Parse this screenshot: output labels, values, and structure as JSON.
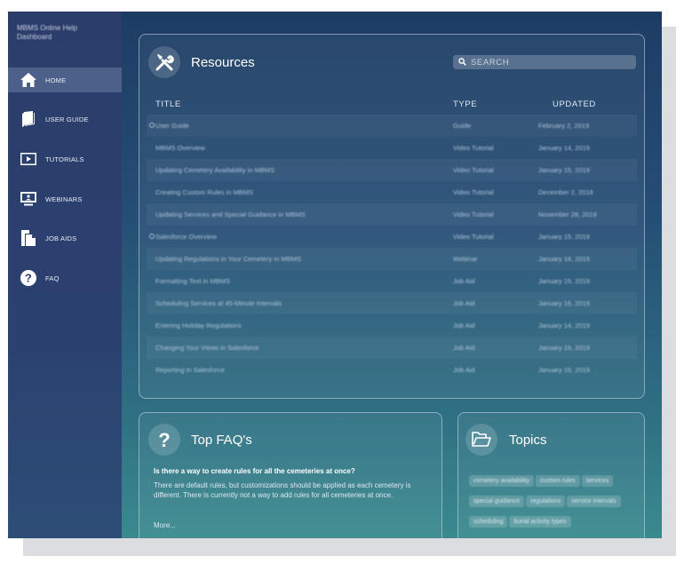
{
  "sidebar": {
    "brand": "MBMS Online Help Dashboard",
    "items": [
      {
        "label": "HOME",
        "icon": "home-icon",
        "active": true
      },
      {
        "label": "USER GUIDE",
        "icon": "book-icon",
        "active": false
      },
      {
        "label": "TUTORIALS",
        "icon": "play-icon",
        "active": false
      },
      {
        "label": "WEBINARS",
        "icon": "presentation-icon",
        "active": false
      },
      {
        "label": "JOB AIDS",
        "icon": "document-icon",
        "active": false
      },
      {
        "label": "FAQ",
        "icon": "question-icon",
        "active": false
      }
    ]
  },
  "resources": {
    "title": "Resources",
    "icon": "tools-icon",
    "search_placeholder": "SEARCH",
    "columns": {
      "title": "TITLE",
      "type": "TYPE",
      "updated": "UPDATED"
    },
    "rows": [
      {
        "title": "User Guide",
        "type": "Guide",
        "updated": "February 2, 2019",
        "marker": true
      },
      {
        "title": "MBMS Overview",
        "type": "Video Tutorial",
        "updated": "January 14, 2019",
        "marker": false
      },
      {
        "title": "Updating Cemetery Availability in MBMS",
        "type": "Video Tutorial",
        "updated": "January 15, 2019",
        "marker": false
      },
      {
        "title": "Creating Custom Rules in MBMS",
        "type": "Video Tutorial",
        "updated": "December 2, 2018",
        "marker": false
      },
      {
        "title": "Updating Services and Special Guidance in MBMS",
        "type": "Video Tutorial",
        "updated": "November 28, 2018",
        "marker": false
      },
      {
        "title": "Salesforce Overview",
        "type": "Video Tutorial",
        "updated": "January 15, 2019",
        "marker": true
      },
      {
        "title": "Updating Regulations in Your Cemetery in MBMS",
        "type": "Webinar",
        "updated": "January 16, 2019",
        "marker": false
      },
      {
        "title": "Formatting Text in MBMS",
        "type": "Job Aid",
        "updated": "January 15, 2019",
        "marker": false
      },
      {
        "title": "Scheduling Services at 45-Minute Intervals",
        "type": "Job Aid",
        "updated": "January 16, 2019",
        "marker": false
      },
      {
        "title": "Entering Holiday Regulations",
        "type": "Job Aid",
        "updated": "January 14, 2019",
        "marker": false
      },
      {
        "title": "Changing Your Views in Salesforce",
        "type": "Job Aid",
        "updated": "January 16, 2019",
        "marker": false
      },
      {
        "title": "Reporting in Salesforce",
        "type": "Job Aid",
        "updated": "January 16, 2019",
        "marker": false
      }
    ]
  },
  "faq": {
    "title": "Top FAQ's",
    "icon": "question-icon",
    "question": "Is there a way to create rules for all the cemeteries at once?",
    "answer": "There are default rules, but customizations should be applied as each cemetery is different. There is currently not a way to add rules for all cemeteries at once.",
    "more": "More..."
  },
  "topics": {
    "title": "Topics",
    "icon": "folder-icon",
    "tags": [
      "cemetery availability",
      "custom rules",
      "services",
      "special guidance",
      "regulations",
      "service intervals",
      "scheduling",
      "burial activity types"
    ]
  }
}
